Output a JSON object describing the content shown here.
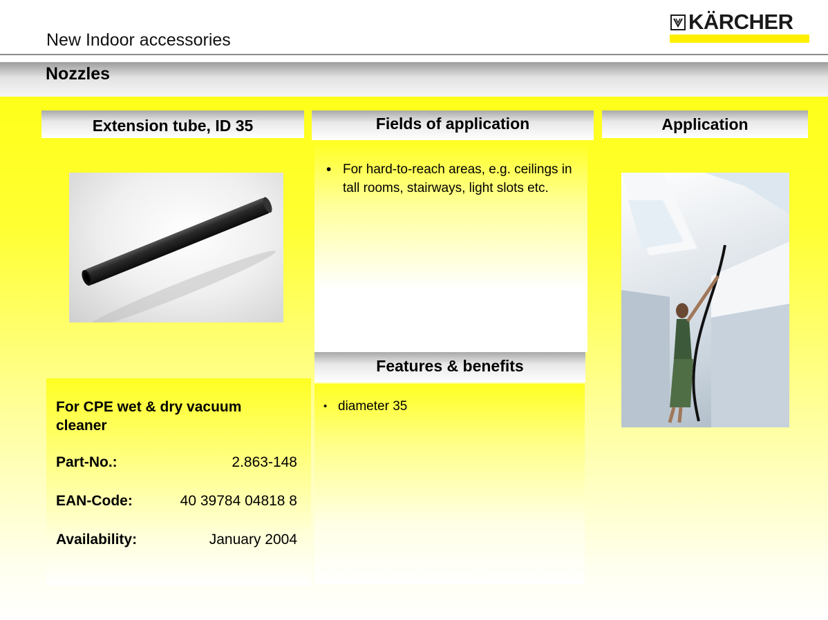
{
  "header": {
    "title": "New Indoor accessories",
    "section_title": "Nozzles",
    "logo_text": "KÄRCHER",
    "brand_color": "#ffef00"
  },
  "columns": {
    "product_heading": "Extension tube, ID 35",
    "fields_heading": "Fields of application",
    "application_heading": "Application",
    "features_heading": "Features & benefits"
  },
  "fields_of_application": [
    "For hard-to-reach areas, e.g. ceilings in tall rooms, stairways, light slots etc."
  ],
  "features_and_benefits": [
    "diameter 35"
  ],
  "product": {
    "description": "For CPE wet & dry  vacuum cleaner",
    "part_no_label": "Part-No.:",
    "part_no": "2.863-148",
    "ean_label": "EAN-Code:",
    "ean": "40 39784 04818 8",
    "availability_label": "Availability:",
    "availability": "January 2004"
  },
  "images": {
    "product_photo": "black-extension-tube-photo",
    "application_photo": "woman-cleaning-ceiling-photo"
  }
}
